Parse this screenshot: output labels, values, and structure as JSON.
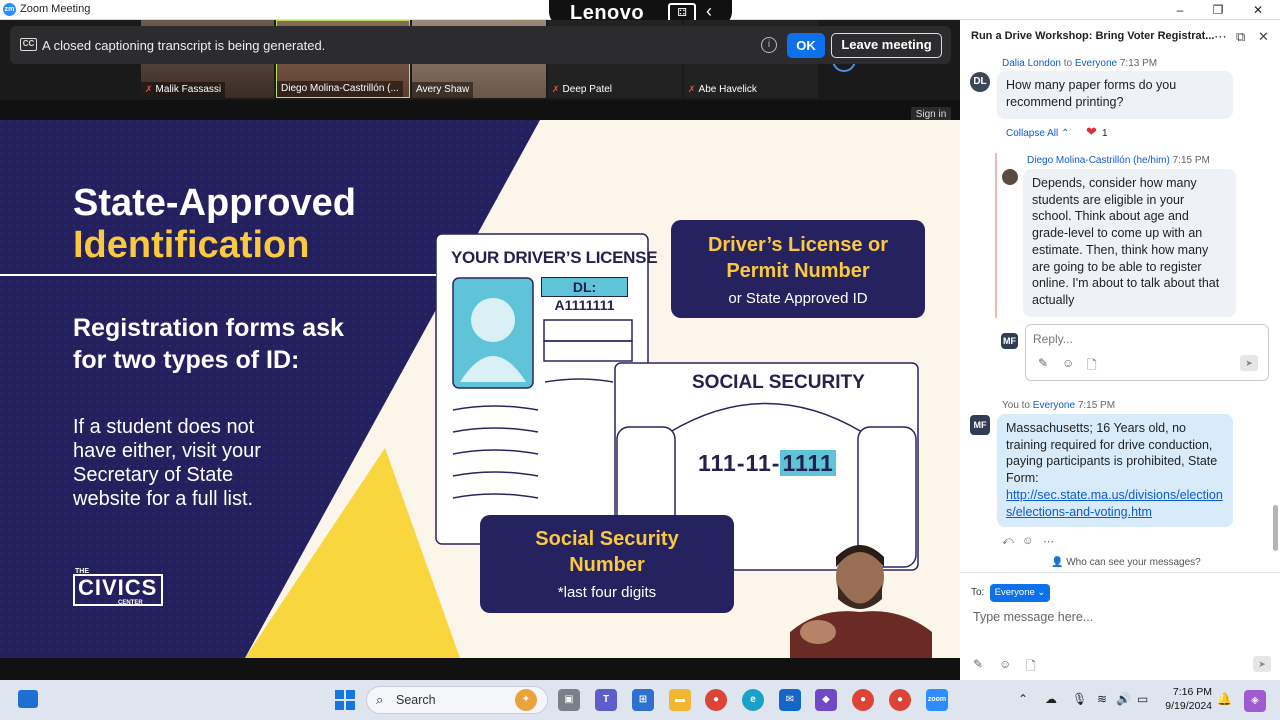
{
  "window": {
    "title": "Zoom Meeting"
  },
  "lenovo": {
    "brand": "Lenovo"
  },
  "participants": [
    "Malik Fassassi",
    "Diego Molina-Castrillón (...",
    "Avery Shaw",
    "Deep Patel",
    "Abe Havelick"
  ],
  "caption_banner": {
    "text": "A closed captioning transcript is being generated.",
    "ok": "OK",
    "leave": "Leave meeting",
    "cc": "CC"
  },
  "sign_in": "Sign in",
  "slide": {
    "title_line1": "State-Approved",
    "title_line2": "Identification",
    "subtitle_line1": "Registration forms ask",
    "subtitle_line2": "for two types of ID:",
    "para_line1": "If a student does not",
    "para_line2": "have either, visit your",
    "para_line3": "Secretary of State",
    "para_line4": "website for a full list.",
    "logo_the": "THE",
    "logo_main": "CIVICS",
    "logo_center": "CENTER",
    "license_title": "YOUR DRIVER’S LICENSE",
    "dl_tag": "DL: A1111111",
    "ss_title": "SOCIAL SECURITY",
    "ss_num_prefix": "111-11-",
    "ss_num_last": "1111",
    "callout1_line1": "Driver’s License or",
    "callout1_line2": "Permit Number",
    "callout1_small": "or State Approved ID",
    "callout2_line1": "Social Security",
    "callout2_line2": "Number",
    "callout2_small": "*last four digits"
  },
  "chat": {
    "title": "Run a Drive Workshop: Bring Voter Registrat...",
    "m1": {
      "initials": "DL",
      "sender": "Dalia London",
      "to_word": "to",
      "recipient": "Everyone",
      "time": "7:13 PM",
      "text": "How many paper forms do you recommend printing?"
    },
    "collapse_all": "Collapse All",
    "reaction_count": "1",
    "m2": {
      "sender": "Diego Molina-Castrillón (he/him)",
      "time": "7:15 PM",
      "text": "Depends, consider how many students are eligible in your school. Think about age and grade-level to come up with an estimate. Then, think how many are going to be able to register online. I'm about to talk about that actually"
    },
    "reply_initials": "MF",
    "reply_placeholder": "Reply...",
    "m3": {
      "initials": "MF",
      "sender": "You",
      "to_word": "to",
      "recipient": "Everyone",
      "time": "7:15 PM",
      "text": "Massachusetts; 16 Years old, no training required for drive conduction, paying participants is prohibited, State Form:",
      "link": "http://sec.state.ma.us/divisions/elections/elections-and-voting.htm"
    },
    "who_can_see": "Who can see your messages?",
    "to_label": "To:",
    "to_value": "Everyone",
    "message_placeholder": "Type message here..."
  },
  "taskbar": {
    "search": "Search",
    "time": "7:16 PM",
    "date": "9/19/2024",
    "zoom_label": "zoom"
  }
}
